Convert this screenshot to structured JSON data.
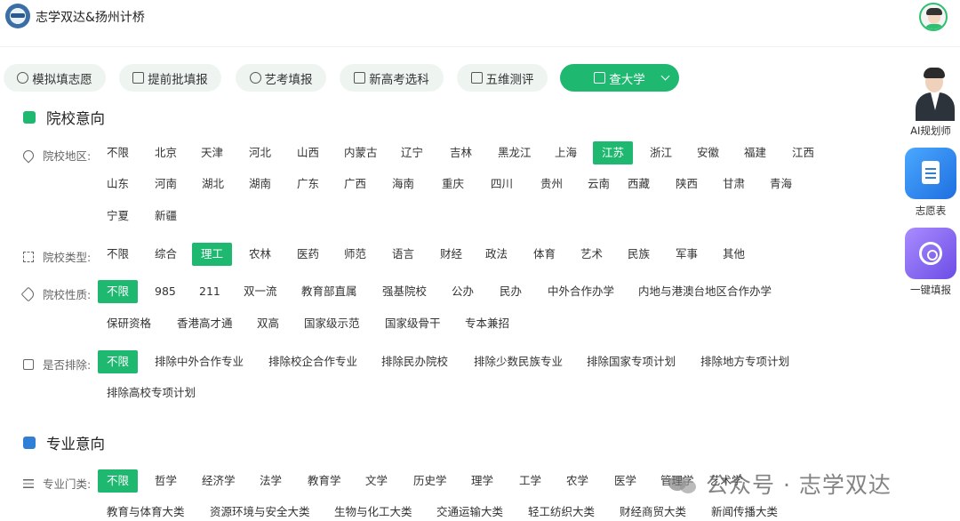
{
  "header": {
    "title": "志学双达&扬州计桥",
    "logo_icon": "logo-icon",
    "avatar_icon": "user-avatar"
  },
  "tabs": [
    {
      "label": "模拟填志愿",
      "icon": "graduation-cap-icon",
      "active": false
    },
    {
      "label": "提前批填报",
      "icon": "document-edit-icon",
      "active": false
    },
    {
      "label": "艺考填报",
      "icon": "palette-icon",
      "active": false
    },
    {
      "label": "新高考选科",
      "icon": "document-list-icon",
      "active": false
    },
    {
      "label": "五维测评",
      "icon": "book-icon",
      "active": false
    },
    {
      "label": "查大学",
      "icon": "university-icon",
      "active": true
    }
  ],
  "accent_color": "#1fb871",
  "sections": {
    "school": {
      "title": "院校意向"
    },
    "major": {
      "title": "专业意向"
    }
  },
  "filters": {
    "region": {
      "label": "院校地区:",
      "selected": "江苏",
      "options": [
        "不限",
        "北京",
        "天津",
        "河北",
        "山西",
        "内蒙古",
        "辽宁",
        "吉林",
        "黑龙江",
        "上海",
        "江苏",
        "浙江",
        "安徽",
        "福建",
        "江西",
        "山东",
        "河南",
        "湖北",
        "湖南",
        "广东",
        "广西",
        "海南",
        "重庆",
        "四川",
        "贵州",
        "云南",
        "西藏",
        "陕西",
        "甘肃",
        "青海",
        "宁夏",
        "新疆"
      ]
    },
    "type": {
      "label": "院校类型:",
      "selected": "理工",
      "options": [
        "不限",
        "综合",
        "理工",
        "农林",
        "医药",
        "师范",
        "语言",
        "财经",
        "政法",
        "体育",
        "艺术",
        "民族",
        "军事",
        "其他"
      ]
    },
    "nature": {
      "label": "院校性质:",
      "selected": "不限",
      "options": [
        "不限",
        "985",
        "211",
        "双一流",
        "教育部直属",
        "强基院校",
        "公办",
        "民办",
        "中外合作办学",
        "内地与港澳台地区合作办学",
        "保研资格",
        "香港高才通",
        "双高",
        "国家级示范",
        "国家级骨干",
        "专本兼招"
      ]
    },
    "exclude": {
      "label": "是否排除:",
      "selected": "不限",
      "options": [
        "不限",
        "排除中外合作专业",
        "排除校企合作专业",
        "排除民办院校",
        "排除少数民族专业",
        "排除国家专项计划",
        "排除地方专项计划",
        "排除高校专项计划"
      ]
    },
    "major_category": {
      "label": "专业门类:",
      "selected": "不限",
      "options": [
        "不限",
        "哲学",
        "经济学",
        "法学",
        "教育学",
        "文学",
        "历史学",
        "理学",
        "工学",
        "农学",
        "医学",
        "管理学",
        "艺术学",
        "教育与体育大类",
        "资源环境与安全大类",
        "生物与化工大类",
        "交通运输大类",
        "轻工纺织大类",
        "财经商贸大类",
        "新闻传播大类"
      ]
    }
  },
  "side_tools": [
    {
      "label": "AI规划师"
    },
    {
      "label": "志愿表"
    },
    {
      "label": "一键填报"
    }
  ],
  "watermark": "公众号 · 志学双达"
}
